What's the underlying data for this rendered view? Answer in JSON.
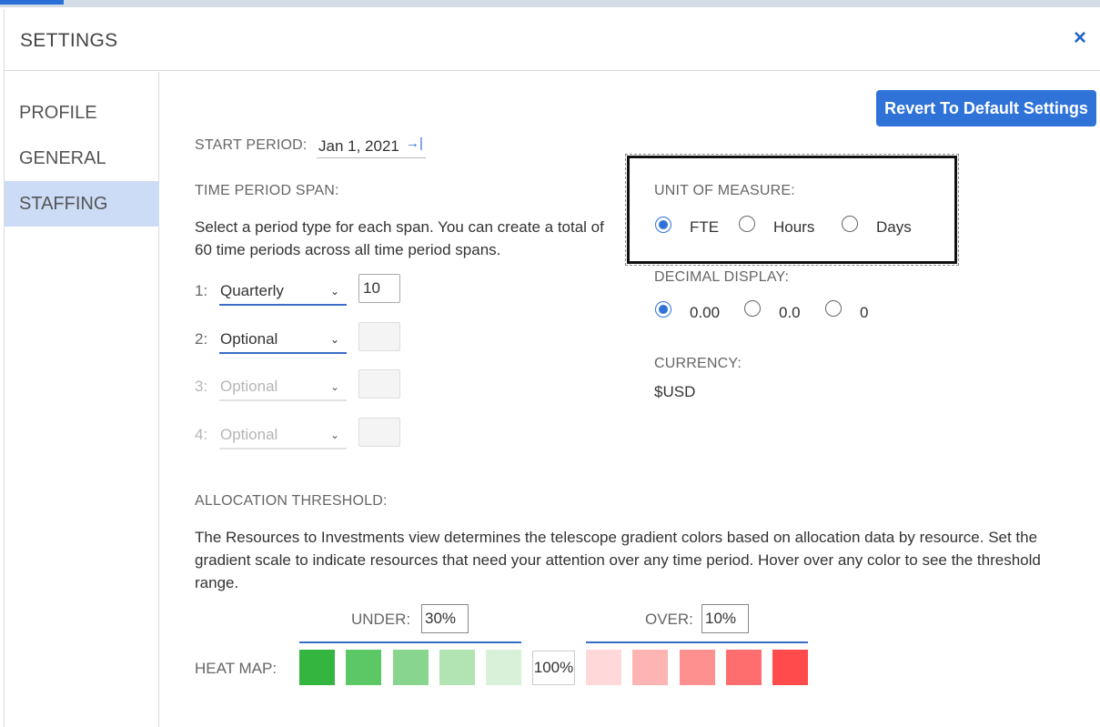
{
  "dialog": {
    "title": "SETTINGS",
    "close_label": "×"
  },
  "sidebar": {
    "items": [
      {
        "label": "PROFILE",
        "active": false
      },
      {
        "label": "GENERAL",
        "active": false
      },
      {
        "label": "STAFFING",
        "active": true
      }
    ]
  },
  "revert_button": "Revert To Default Settings",
  "start_period": {
    "label": "START PERIOD:",
    "value": "Jan 1, 2021",
    "icon": "arrow-right-to-bar-icon"
  },
  "time_period_span": {
    "label": "TIME PERIOD SPAN:",
    "description": "Select a period type for each span. You can create a total of 60 time periods across all time period spans.",
    "rows": [
      {
        "num": "1:",
        "select": "Quarterly",
        "value": "10",
        "enabled": true
      },
      {
        "num": "2:",
        "select": "Optional",
        "value": "",
        "enabled": true
      },
      {
        "num": "3:",
        "select": "Optional",
        "value": "",
        "enabled": false
      },
      {
        "num": "4:",
        "select": "Optional",
        "value": "",
        "enabled": false
      }
    ]
  },
  "unit_of_measure": {
    "label": "UNIT OF MEASURE:",
    "options": [
      "FTE",
      "Hours",
      "Days"
    ],
    "selected": "FTE"
  },
  "decimal_display": {
    "label": "DECIMAL DISPLAY:",
    "options": [
      "0.00",
      "0.0",
      "0"
    ],
    "selected": "0.00"
  },
  "currency": {
    "label": "CURRENCY:",
    "value": "$USD"
  },
  "allocation_threshold": {
    "label": "ALLOCATION THRESHOLD:",
    "description": "The Resources to Investments view determines the telescope gradient colors based on allocation data by resource. Set the gradient scale to indicate resources that need your attention over any time period. Hover over any color to see the threshold range.",
    "under_label": "UNDER:",
    "under_value": "30%",
    "over_label": "OVER:",
    "over_value": "10%",
    "heat_map_label": "HEAT MAP:",
    "center_value": "100%",
    "under_colors": [
      "#33b540",
      "#5cc765",
      "#88d68d",
      "#b2e4b3",
      "#d9f1d9"
    ],
    "over_colors": [
      "#ffd9d9",
      "#ffb4b4",
      "#ff9090",
      "#ff6e6e",
      "#ff4b4b"
    ]
  },
  "colors": {
    "accent": "#2f73d9",
    "active_nav": "#ccdcf6"
  }
}
